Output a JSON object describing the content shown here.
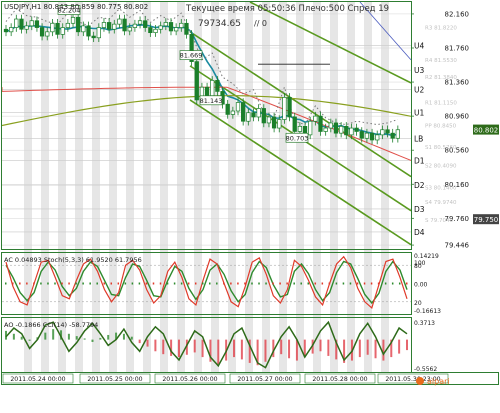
{
  "header": {
    "symbol_line": "USDJPY,H1  80.843 80.859 80.775 80.802",
    "server_time": "Текущее время 05:50:36 Плечо:500 Спред 19",
    "big_number": "79734.65",
    "big_suffix": "// 0"
  },
  "colors": {
    "grid": "#2e7d32",
    "candle": "#1b7f2b",
    "price_badge": "#2e6b1a",
    "ma_blue": "#1a8aa0",
    "ma_red": "#e0504a",
    "ma_olive": "#8aa020",
    "channel": "#5a9a20",
    "stoch_red": "#e03a2a",
    "stoch_green": "#2e8b2e",
    "cci_line": "#2e6b1a",
    "ao_bar": "#e0404a"
  },
  "chart_data": [
    {
      "type": "candlestick",
      "title": "USDJPY,H1",
      "ylim": [
        79.4,
        82.3
      ],
      "y_ticks": [
        "82.160",
        "81.760",
        "81.360",
        "80.960",
        "80.560",
        "80.160",
        "79.760",
        "79.446"
      ],
      "x_labels": [
        "2011.05.24 00:00",
        "2011.05.25 00:00",
        "2011.05.26 00:00",
        "2011.05.27 00:00",
        "2011.05.28 00:00",
        "2011.05.30 23:00"
      ],
      "current_price": "80.802",
      "highlight_price": "79.750",
      "annotations": [
        "82.204",
        "81.669",
        "81.143",
        "80.703"
      ],
      "levels": [
        {
          "label": "U4",
          "value": 81.79
        },
        {
          "label": "U3",
          "value": 81.5
        },
        {
          "label": "U2",
          "value": 81.27
        },
        {
          "label": "U1",
          "value": 81.0
        },
        {
          "label": "LB",
          "value": 80.7
        },
        {
          "label": "D1",
          "value": 80.44
        },
        {
          "label": "D2",
          "value": 80.15
        },
        {
          "label": "D3",
          "value": 79.87
        },
        {
          "label": "D4",
          "value": 79.6
        }
      ],
      "level_hints": [
        "R3 81.8220",
        "R4 81.5530",
        "R2 81.3840",
        "R1 81.1150",
        "PP 80.8450",
        "S1 80.5760",
        "S2 80.4090",
        "S3 80.1400",
        "S4 79.9740",
        "S 79.7040"
      ],
      "close": [
        81.95,
        82.0,
        82.1,
        81.98,
        82.02,
        82.08,
        82.0,
        81.9,
        81.95,
        82.05,
        81.92,
        82.0,
        82.05,
        82.12,
        81.95,
        82.02,
        81.9,
        81.88,
        82.0,
        82.06,
        81.98,
        82.04,
        82.1,
        81.96,
        82.0,
        82.04,
        82.08,
        82.0,
        81.94,
        81.98,
        82.02,
        82.06,
        81.96,
        82.0,
        82.05,
        81.92,
        81.6,
        81.15,
        81.3,
        81.2,
        81.38,
        81.25,
        81.1,
        80.98,
        81.02,
        81.12,
        80.9,
        81.0,
        80.95,
        81.05,
        80.88,
        80.95,
        80.82,
        80.92,
        81.18,
        80.95,
        80.78,
        80.84,
        80.74,
        80.9,
        80.96,
        80.78,
        80.82,
        80.88,
        80.76,
        80.84,
        80.74,
        80.82,
        80.78,
        80.7,
        80.76,
        80.68,
        80.74,
        80.8,
        80.76,
        80.7,
        80.8
      ]
    },
    {
      "type": "line",
      "title": "AC 0.04893  Stoch(5,3,3) 61.9520 61.7956",
      "ylim": [
        -0.16613,
        0.14219
      ],
      "y_ticks": [
        "0.14219",
        "100",
        "80",
        "20",
        "0.00",
        "-0.16613"
      ],
      "series": [
        {
          "name": "Stoch(5,3,3)",
          "values": [
            85,
            45,
            20,
            15,
            50,
            85,
            88,
            60,
            30,
            25,
            55,
            82,
            90,
            70,
            40,
            20,
            35,
            80,
            88,
            72,
            40,
            18,
            30,
            70,
            85,
            60,
            25,
            15,
            55,
            90,
            82,
            50,
            20,
            12,
            45,
            85,
            92,
            65,
            30,
            18,
            40,
            88,
            78,
            55,
            28,
            15,
            50,
            82,
            94,
            76,
            42,
            20,
            10,
            48,
            86,
            90,
            60,
            25
          ]
        },
        {
          "name": "Signal",
          "values": [
            80,
            60,
            35,
            22,
            35,
            70,
            85,
            72,
            45,
            30,
            42,
            70,
            85,
            78,
            55,
            32,
            30,
            60,
            82,
            78,
            55,
            30,
            28,
            55,
            78,
            70,
            42,
            24,
            40,
            72,
            82,
            65,
            38,
            20,
            32,
            68,
            86,
            76,
            48,
            28,
            32,
            70,
            82,
            66,
            40,
            22,
            35,
            68,
            86,
            82,
            58,
            32,
            18,
            34,
            70,
            86,
            72,
            40
          ]
        }
      ]
    },
    {
      "type": "bar",
      "title": "AO -0.1866  CCI(14) -58.7794",
      "ylim": [
        -0.5562,
        0.3713
      ],
      "y_ticks": [
        "0.3713",
        "-0.5562"
      ],
      "series": [
        {
          "name": "AO",
          "values": [
            0.15,
            0.1,
            0.05,
            -0.02,
            0.04,
            0.12,
            0.18,
            0.16,
            0.1,
            0.06,
            0.02,
            -0.04,
            0.03,
            0.08,
            0.12,
            0.1,
            0.05,
            -0.06,
            -0.12,
            -0.2,
            -0.25,
            -0.28,
            -0.3,
            -0.26,
            -0.22,
            -0.3,
            -0.38,
            -0.42,
            -0.36,
            -0.3,
            -0.34,
            -0.4,
            -0.44,
            -0.38,
            -0.3,
            -0.25,
            -0.32,
            -0.36,
            -0.3,
            -0.24,
            -0.2,
            -0.28,
            -0.34,
            -0.4,
            -0.36,
            -0.3,
            -0.26,
            -0.32,
            -0.36,
            -0.3,
            -0.24,
            -0.18
          ]
        },
        {
          "name": "CCI(14)",
          "values": [
            0.05,
            0.2,
            0.1,
            -0.15,
            0.0,
            0.25,
            0.3,
            0.05,
            -0.2,
            -0.05,
            0.15,
            0.28,
            0.1,
            -0.1,
            0.0,
            0.18,
            -0.05,
            -0.2,
            0.05,
            0.22,
            0.1,
            -0.2,
            -0.35,
            -0.1,
            0.15,
            0.05,
            -0.3,
            -0.45,
            -0.2,
            0.1,
            0.2,
            -0.1,
            -0.4,
            -0.48,
            -0.2,
            0.05,
            0.22,
            0.0,
            -0.3,
            -0.1,
            0.15,
            0.3,
            -0.05,
            -0.35,
            -0.2,
            0.1,
            0.28,
            0.05,
            -0.25,
            -0.05,
            0.2,
            0.1
          ]
        }
      ]
    }
  ]
}
